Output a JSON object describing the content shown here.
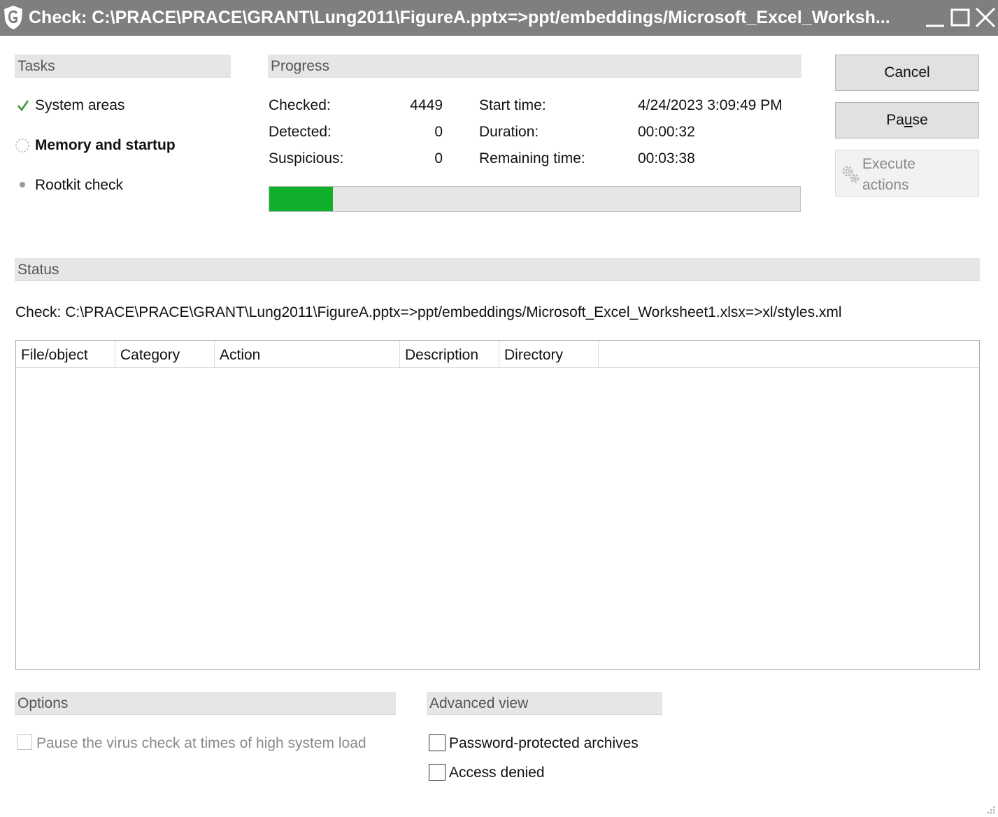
{
  "window": {
    "title": "Check: C:\\PRACE\\PRACE\\GRANT\\Lung2011\\FigureA.pptx=>ppt/embeddings/Microsoft_Excel_Worksh..."
  },
  "tasks": {
    "header": "Tasks",
    "items": [
      {
        "label": "System areas",
        "state": "done"
      },
      {
        "label": "Memory and startup",
        "state": "running"
      },
      {
        "label": "Rootkit check",
        "state": "pending"
      }
    ]
  },
  "progress": {
    "header": "Progress",
    "checked_label": "Checked:",
    "checked_value": "4449",
    "detected_label": "Detected:",
    "detected_value": "0",
    "suspicious_label": "Suspicious:",
    "suspicious_value": "0",
    "start_label": "Start time:",
    "start_value": "4/24/2023 3:09:49 PM",
    "duration_label": "Duration:",
    "duration_value": "00:00:32",
    "remaining_label": "Remaining time:",
    "remaining_value": "00:03:38",
    "fraction": 0.12,
    "bar_color": "#10b02c"
  },
  "buttons": {
    "cancel": "Cancel",
    "pause": "Pause",
    "execute_line1": "Execute",
    "execute_line2": "actions"
  },
  "status": {
    "header": "Status",
    "text": "Check: C:\\PRACE\\PRACE\\GRANT\\Lung2011\\FigureA.pptx=>ppt/embeddings/Microsoft_Excel_Worksheet1.xlsx=>xl/styles.xml"
  },
  "results": {
    "columns": [
      "File/object",
      "Category",
      "Action",
      "Description",
      "Directory"
    ]
  },
  "options": {
    "header": "Options",
    "pause_high_load": "Pause the virus check at times of high system load"
  },
  "advanced": {
    "header": "Advanced view",
    "password_protected": "Password-protected archives",
    "access_denied": "Access denied"
  }
}
